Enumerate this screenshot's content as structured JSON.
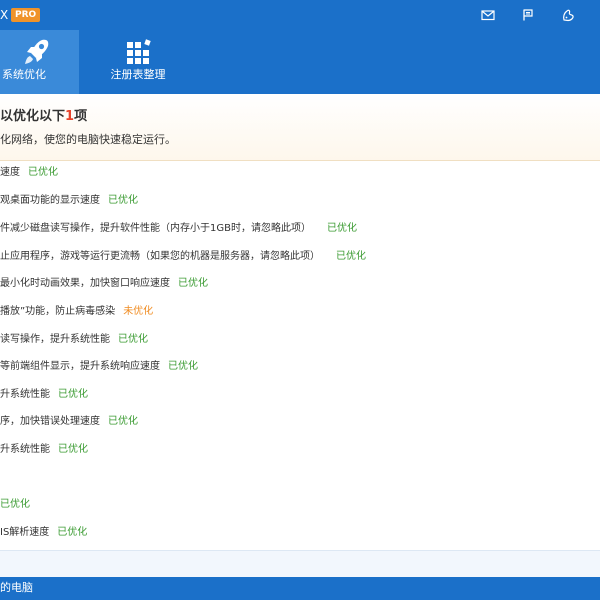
{
  "titlebar": {
    "brand_fragment": "X",
    "pro_badge": "PRO",
    "icons": [
      "mail-icon",
      "feedback-icon",
      "skin-icon"
    ]
  },
  "tabs": [
    {
      "label": "系统优化",
      "icon": "rocket-icon",
      "active": true
    },
    {
      "label": "注册表整理",
      "icon": "registry-cubes-icon",
      "active": false
    }
  ],
  "summary": {
    "title_prefix": "以优化以下",
    "count": "1",
    "title_suffix": "项",
    "subtitle": "化网络，使您的电脑快速稳定运行。"
  },
  "items": [
    {
      "text": "速度",
      "status": "已优化",
      "optimized": true
    },
    {
      "text": "观桌面功能的显示速度",
      "status": "已优化",
      "optimized": true
    },
    {
      "text": "件减少磁盘读写操作，提升软件性能（内存小于1GB时，请忽略此项）",
      "status": "已优化",
      "optimized": true
    },
    {
      "text": "止应用程序，游戏等运行更流畅（如果您的机器是服务器，请忽略此项）",
      "status": "已优化",
      "optimized": true
    },
    {
      "text": "最小化时动画效果，加快窗口响应速度",
      "status": "已优化",
      "optimized": true
    },
    {
      "text": "播放”功能，防止病毒感染",
      "status": "未优化",
      "optimized": false
    },
    {
      "text": "读写操作，提升系统性能",
      "status": "已优化",
      "optimized": true
    },
    {
      "text": "等前端组件显示，提升系统响应速度",
      "status": "已优化",
      "optimized": true
    },
    {
      "text": "升系统性能",
      "status": "已优化",
      "optimized": true
    },
    {
      "text": "序，加快错误处理速度",
      "status": "已优化",
      "optimized": true
    },
    {
      "text": "升系统性能",
      "status": "已优化",
      "optimized": true
    },
    {
      "text": "",
      "status": "已优化",
      "optimized": true
    },
    {
      "text": "IS解析速度",
      "status": "已优化",
      "optimized": true
    }
  ],
  "statusbar": {
    "text": "的电脑"
  },
  "colors": {
    "brand_blue": "#1b70c9",
    "active_tab": "#3a8ad9",
    "ok_green": "#3b9b32",
    "warn_orange": "#f08c22",
    "count_red": "#e8442c",
    "pro_orange": "#f0932a"
  }
}
